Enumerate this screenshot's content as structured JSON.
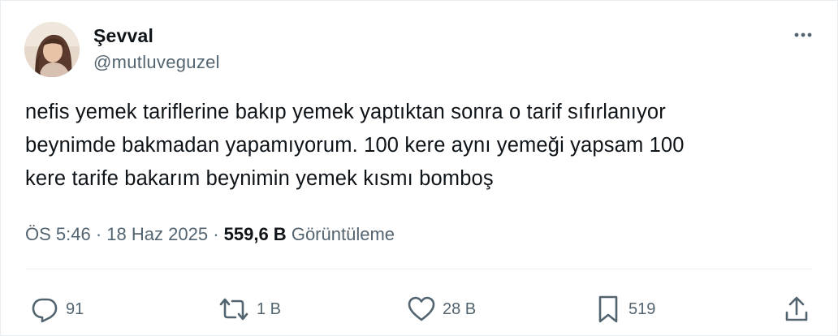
{
  "author": {
    "display_name": "Şevval",
    "handle": "@mutluveguzel"
  },
  "tweet": {
    "text": "nefis yemek tariflerine bakıp yemek yaptıktan sonra o tarif sıfırlanıyor\nbeynimde bakmadan yapamıyorum. 100 kere aynı yemeği yapsam 100\nkere tarife bakarım beynimin yemek kısmı bomboş"
  },
  "meta": {
    "time": "ÖS 5:46",
    "separator": "·",
    "date": "18 Haz 2025",
    "views_count": "559,6 B",
    "views_label": "Görüntüleme"
  },
  "actions": {
    "replies": "91",
    "reposts": "1 B",
    "likes": "28 B",
    "bookmarks": "519"
  },
  "icons": {
    "reply": "speech-bubble-icon",
    "repost": "repost-arrows-icon",
    "like": "heart-icon",
    "bookmark": "bookmark-icon",
    "share": "share-upload-icon",
    "more": "more-horizontal-icon"
  },
  "colors": {
    "text_primary": "#0f1419",
    "text_secondary": "#536471",
    "divider": "#eff3f4"
  }
}
